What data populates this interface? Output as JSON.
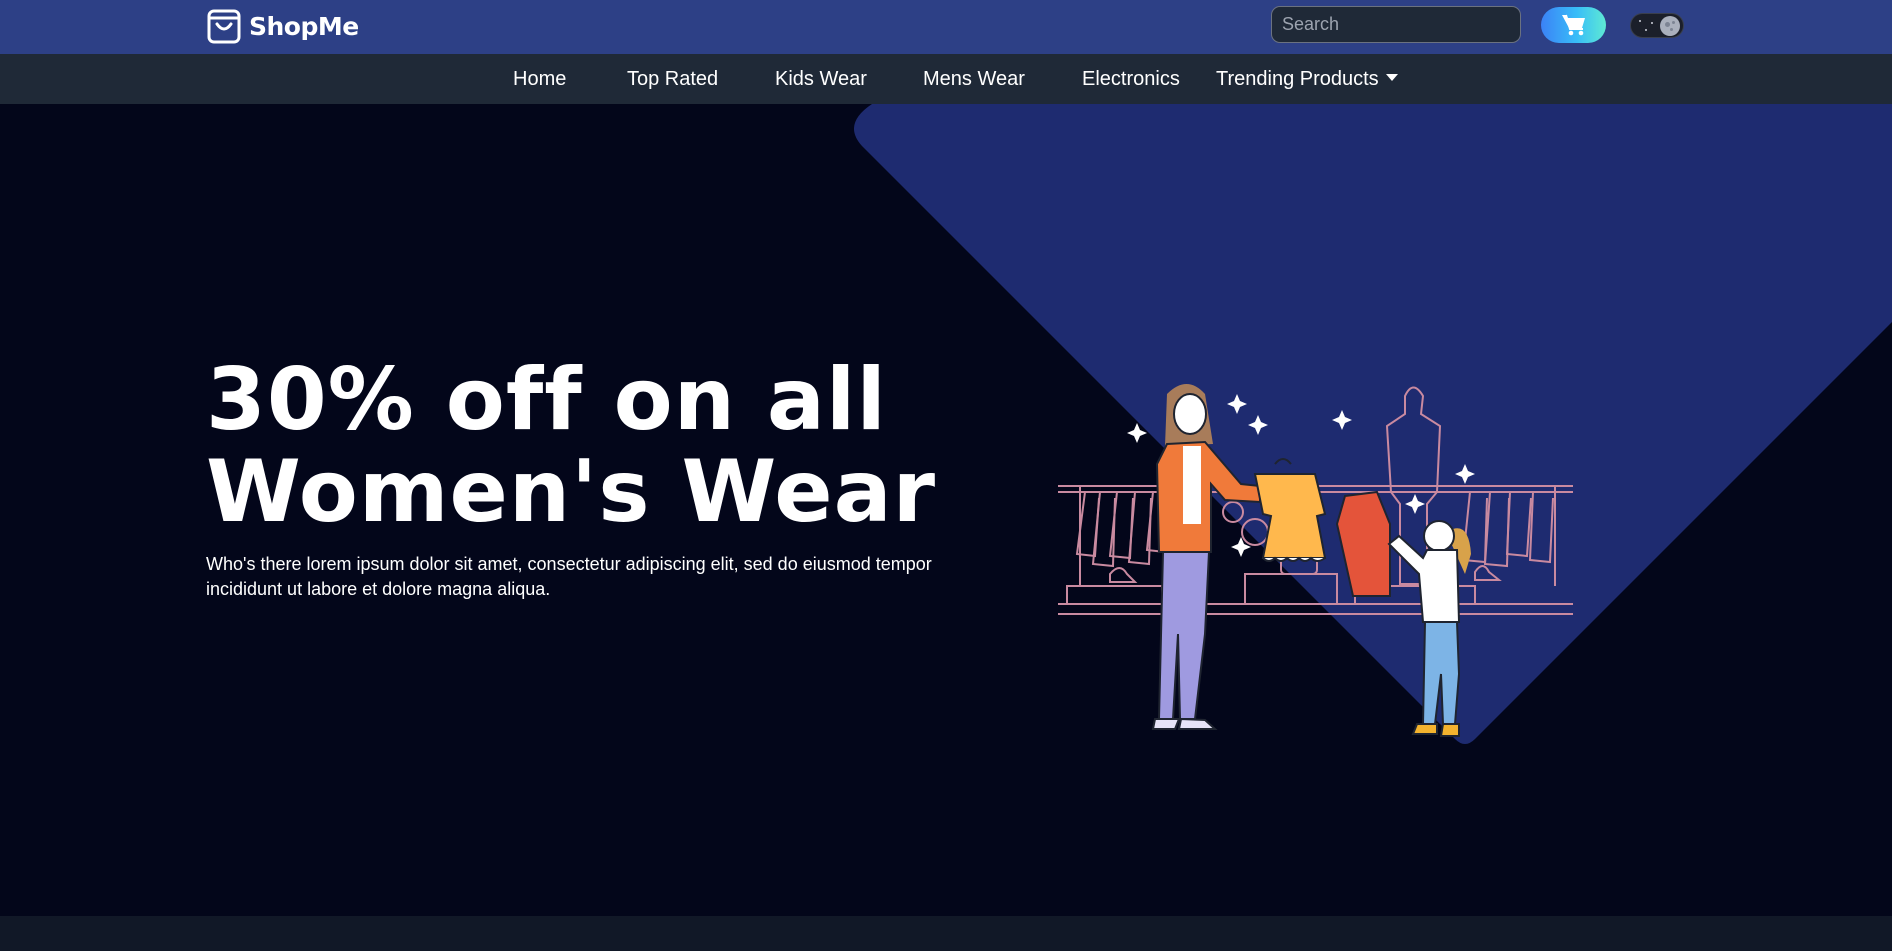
{
  "brand": {
    "name": "ShopMe",
    "logo_icon": "shopping-bag-icon"
  },
  "header": {
    "search_placeholder": "Search",
    "cart_icon": "cart-icon",
    "mode_toggle_icon": "moon-icon"
  },
  "nav": {
    "items": [
      {
        "label": "Home"
      },
      {
        "label": "Top Rated"
      },
      {
        "label": "Kids Wear"
      },
      {
        "label": "Mens Wear"
      },
      {
        "label": "Electronics"
      },
      {
        "label": "Trending Products",
        "has_dropdown": true
      }
    ]
  },
  "hero": {
    "title_line1": "30% off on all",
    "title_line2": "Women's Wear",
    "description": "Who's there lorem ipsum dolor sit amet, consectetur adipiscing elit, sed do eiusmod tempor incididunt ut labore et dolore magna aliqua.",
    "illustration": "women-shopping-illustration"
  },
  "colors": {
    "topbar": "#2d4086",
    "navbar": "#1f2937",
    "hero_bg": "#03061a",
    "hero_accent": "#1e2b70",
    "cart_gradient_start": "#3b82f6",
    "cart_gradient_end": "#5eead4"
  }
}
